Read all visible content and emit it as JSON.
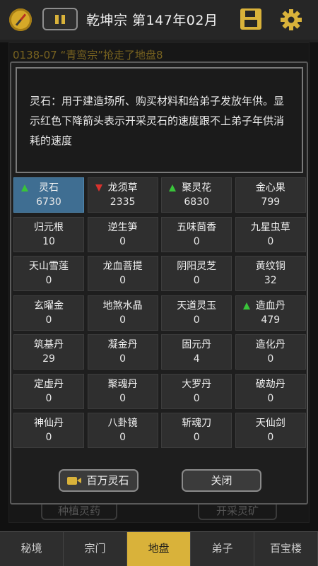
{
  "header": {
    "title": "乾坤宗 第147年02月"
  },
  "background": {
    "log_text": "0138-07 “青鸾宗”抢走了地盘8",
    "left_button": "种植灵药",
    "right_button": "开采灵矿",
    "nav": [
      "秘境",
      "宗门",
      "地盘",
      "弟子",
      "百宝楼"
    ],
    "active_nav": "地盘"
  },
  "modal": {
    "tip_text": "灵石：用于建造场所、购买材料和给弟子发放年供。显示红色下降箭头表示开采灵石的速度跟不上弟子年供消耗的速度",
    "items": [
      {
        "name": "灵石",
        "value": "6730",
        "trend": "up",
        "selected": true
      },
      {
        "name": "龙须草",
        "value": "2335",
        "trend": "down"
      },
      {
        "name": "聚灵花",
        "value": "6830",
        "trend": "up"
      },
      {
        "name": "金心果",
        "value": "799",
        "trend": ""
      },
      {
        "name": "归元根",
        "value": "10",
        "trend": ""
      },
      {
        "name": "逆生笋",
        "value": "0",
        "trend": ""
      },
      {
        "name": "五味茴香",
        "value": "0",
        "trend": ""
      },
      {
        "name": "九星虫草",
        "value": "0",
        "trend": ""
      },
      {
        "name": "天山雪莲",
        "value": "0",
        "trend": ""
      },
      {
        "name": "龙血菩提",
        "value": "0",
        "trend": ""
      },
      {
        "name": "阴阳灵芝",
        "value": "0",
        "trend": ""
      },
      {
        "name": "黄纹铜",
        "value": "32",
        "trend": ""
      },
      {
        "name": "玄曜金",
        "value": "0",
        "trend": ""
      },
      {
        "name": "地煞水晶",
        "value": "0",
        "trend": ""
      },
      {
        "name": "天道灵玉",
        "value": "0",
        "trend": ""
      },
      {
        "name": "造血丹",
        "value": "479",
        "trend": "up"
      },
      {
        "name": "筑基丹",
        "value": "29",
        "trend": ""
      },
      {
        "name": "凝金丹",
        "value": "0",
        "trend": ""
      },
      {
        "name": "固元丹",
        "value": "4",
        "trend": ""
      },
      {
        "name": "造化丹",
        "value": "0",
        "trend": ""
      },
      {
        "name": "定虚丹",
        "value": "0",
        "trend": ""
      },
      {
        "name": "聚魂丹",
        "value": "0",
        "trend": ""
      },
      {
        "name": "大罗丹",
        "value": "0",
        "trend": ""
      },
      {
        "name": "破劫丹",
        "value": "0",
        "trend": ""
      },
      {
        "name": "神仙丹",
        "value": "0",
        "trend": ""
      },
      {
        "name": "八卦镜",
        "value": "0",
        "trend": ""
      },
      {
        "name": "斩魂刀",
        "value": "0",
        "trend": ""
      },
      {
        "name": "天仙剑",
        "value": "0",
        "trend": ""
      }
    ],
    "ad_button": "百万灵石",
    "close_button": "关闭"
  },
  "colors": {
    "accent": "#d9b23a",
    "selected_cell": "#3f6e92",
    "trend_up": "#39c43a",
    "trend_down": "#d8322d"
  }
}
